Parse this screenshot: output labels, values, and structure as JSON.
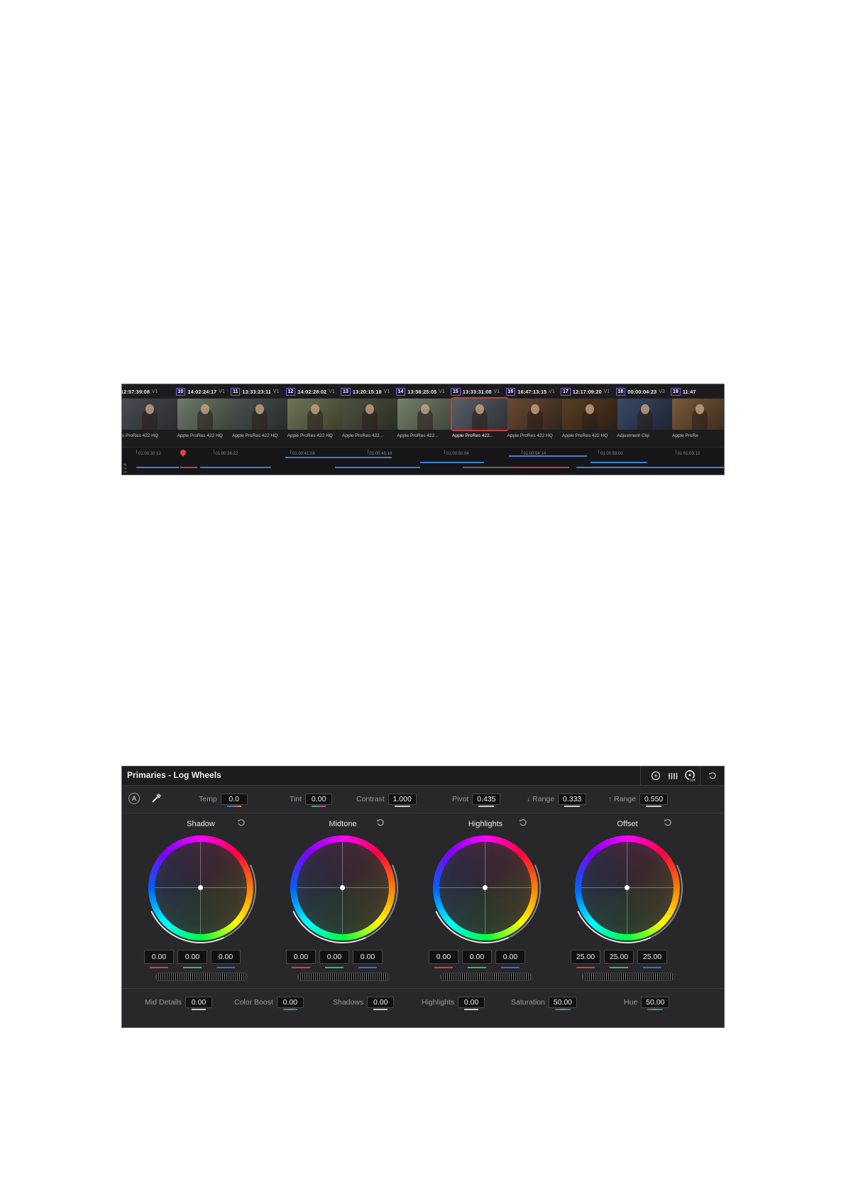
{
  "timeline": {
    "clips": [
      {
        "num": "",
        "tc": "12:57:39:08",
        "track": "V1",
        "codec": "s ProRes 422 HQ",
        "colors": [
          "#4a4a52",
          "#2a2a30"
        ],
        "selected": false
      },
      {
        "num": "10",
        "tc": "14:02:24:17",
        "track": "V1",
        "codec": "Apple ProRes 422 HQ",
        "colors": [
          "#6f7a6a",
          "#3a4236"
        ],
        "selected": false
      },
      {
        "num": "11",
        "tc": "13:33:23:11",
        "track": "V1",
        "codec": "Apple ProRes 422 HQ",
        "colors": [
          "#4a5250",
          "#282c2a"
        ],
        "selected": false
      },
      {
        "num": "12",
        "tc": "14:02:28:02",
        "track": "V1",
        "codec": "Apple ProRes 422 HQ",
        "colors": [
          "#6f7558",
          "#3a3e2a"
        ],
        "selected": false
      },
      {
        "num": "13",
        "tc": "13:20:15:18",
        "track": "V1",
        "codec": "Apple ProRes 422...",
        "colors": [
          "#4e5240",
          "#2a2c22"
        ],
        "selected": false
      },
      {
        "num": "14",
        "tc": "13:58:25:05",
        "track": "V1",
        "codec": "Apple ProRes 422...",
        "colors": [
          "#74806a",
          "#3e4638"
        ],
        "selected": false
      },
      {
        "num": "15",
        "tc": "13:33:31:08",
        "track": "V1",
        "codec": "Apple ProRes 422...",
        "colors": [
          "#5a6068",
          "#2c3034"
        ],
        "selected": true
      },
      {
        "num": "16",
        "tc": "16:47:13:15",
        "track": "V1",
        "codec": "Apple ProRes 422 HQ",
        "colors": [
          "#6a4a34",
          "#30221a"
        ],
        "selected": false
      },
      {
        "num": "17",
        "tc": "12:17:09:20",
        "track": "V1",
        "codec": "Apple ProRes 422 HQ",
        "colors": [
          "#5a3e26",
          "#2a1e14"
        ],
        "selected": false
      },
      {
        "num": "18",
        "tc": "00:00:04:23",
        "track": "V3",
        "codec": "Adjustment Clip",
        "colors": [
          "#3a4a66",
          "#1c2434"
        ],
        "selected": false
      },
      {
        "num": "19",
        "tc": "11:47",
        "track": "",
        "codec": "Apple ProRe",
        "colors": [
          "#7a5a3a",
          "#3a2a1c"
        ],
        "selected": false
      }
    ],
    "ruler": [
      "01:00:32:12",
      "01:00:36:22",
      "01:00:41:08",
      "01:00:45:18",
      "01:00:50:04",
      "01:00:54:14",
      "01:00:59:00",
      "01:01:03:10"
    ],
    "side_label": "1 2 3"
  },
  "panel": {
    "title": "Primaries - Log Wheels",
    "auto_label": "A",
    "params_top": [
      {
        "label": "Temp",
        "value": "0.0"
      },
      {
        "label": "Tint",
        "value": "0.00"
      },
      {
        "label": "Contrast",
        "value": "1.000"
      },
      {
        "label": "Pivot",
        "value": "0.435"
      },
      {
        "label": "↓ Range",
        "value": "0.333"
      },
      {
        "label": "↑ Range",
        "value": "0.550"
      }
    ],
    "wheels": [
      {
        "title": "Shadow",
        "values": [
          "0.00",
          "0.00",
          "0.00"
        ]
      },
      {
        "title": "Midtone",
        "values": [
          "0.00",
          "0.00",
          "0.00"
        ]
      },
      {
        "title": "Highlights",
        "values": [
          "0.00",
          "0.00",
          "0.00"
        ]
      },
      {
        "title": "Offset",
        "values": [
          "25.00",
          "25.00",
          "25.00"
        ]
      }
    ],
    "params_bottom": [
      {
        "label": "Mid Details",
        "value": "0.00"
      },
      {
        "label": "Color Boost",
        "value": "0.00"
      },
      {
        "label": "Shadows",
        "value": "0.00"
      },
      {
        "label": "Highlights",
        "value": "0.00"
      },
      {
        "label": "Saturation",
        "value": "50.00"
      },
      {
        "label": "Hue",
        "value": "50.00"
      }
    ],
    "header_icons": [
      "wheels-mode-icon",
      "bars-mode-icon",
      "log-mode-icon",
      "reset-all-icon"
    ],
    "colors": {
      "red": "#e03a3a",
      "green": "#3ac04a",
      "blue": "#3a6ae0",
      "accent": "#7a5cff"
    }
  }
}
